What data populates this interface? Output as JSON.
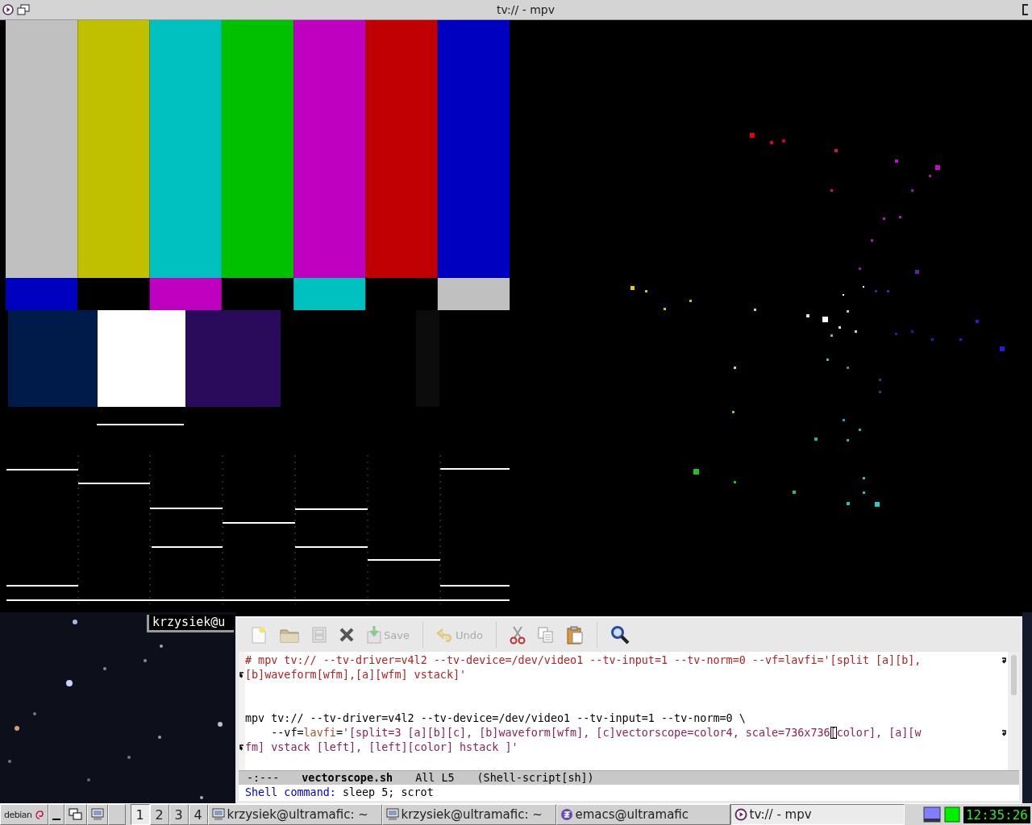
{
  "window": {
    "title": "tv:// - mpv"
  },
  "terminal": {
    "text": "krzysiek@u"
  },
  "editor": {
    "toolbar": [
      {
        "kind": "new",
        "disabled": false
      },
      {
        "kind": "open",
        "disabled": false
      },
      {
        "kind": "disk",
        "disabled": true
      },
      {
        "kind": "close",
        "disabled": false
      },
      {
        "kind": "save",
        "label": "Save",
        "disabled": true
      },
      {
        "kind": "separator"
      },
      {
        "kind": "undo",
        "label": "Undo",
        "disabled": true
      },
      {
        "kind": "separator"
      },
      {
        "kind": "cut",
        "disabled": false
      },
      {
        "kind": "copy",
        "disabled": false
      },
      {
        "kind": "paste",
        "disabled": false
      },
      {
        "kind": "separator"
      },
      {
        "kind": "search",
        "disabled": false
      }
    ],
    "lines": [
      {
        "kind": "code",
        "wrap_end": true,
        "segments": [
          {
            "kind": "comment",
            "text": "# mpv tv:// --tv-driver=v4l2 --tv-device=/dev/video1 --tv-input=1 --tv-norm=0 --vf=lavfi='[split [a][b],"
          }
        ]
      },
      {
        "kind": "code",
        "wrap_start": true,
        "segments": [
          {
            "kind": "comment",
            "text": "[b]waveform[wfm],[a][wfm] vstack]'"
          }
        ]
      },
      {
        "kind": "blank"
      },
      {
        "kind": "blank"
      },
      {
        "kind": "code",
        "segments": [
          {
            "kind": "plain",
            "text": "mpv tv:// --tv-driver=v4l2 --tv-device=/dev/video1 --tv-input=1 --tv-norm=0 \\"
          }
        ]
      },
      {
        "kind": "code",
        "wrap_end": true,
        "segments": [
          {
            "kind": "plain",
            "text": "    --vf="
          },
          {
            "kind": "variable",
            "text": "lavfi"
          },
          {
            "kind": "plain",
            "text": "="
          },
          {
            "kind": "string",
            "text": "'[split=3 [a][b][c], [b]waveform[wfm], [c]vectorscope=color4, scale=736x736"
          },
          {
            "kind": "cursor",
            "text": "["
          },
          {
            "kind": "string",
            "text": "color], [a][w"
          }
        ]
      },
      {
        "kind": "code",
        "wrap_start": true,
        "segments": [
          {
            "kind": "string",
            "text": "fm] vstack [left], [left][color] hstack ]'"
          }
        ]
      }
    ],
    "mode_line": [
      {
        "kind": "plain",
        "text": "-:---"
      },
      {
        "kind": "buffer",
        "text": "vectorscope.sh"
      },
      {
        "kind": "plain",
        "text": "All L5"
      },
      {
        "kind": "plain",
        "text": "(Shell-script[sh])"
      }
    ],
    "minibuffer": {
      "prompt": "Shell command:",
      "value": "sleep 5; scrot"
    }
  },
  "taskbar": {
    "start": "debian",
    "desktops": [
      {
        "label": "1",
        "selected": true
      },
      {
        "label": "2",
        "selected": false
      },
      {
        "label": "3",
        "selected": false
      },
      {
        "label": "4",
        "selected": false
      }
    ],
    "tasks": [
      {
        "kind": "terminal",
        "label": "krzysiek@ultramafic: ~",
        "selected": false
      },
      {
        "kind": "terminal",
        "label": "krzysiek@ultramafic: ~",
        "selected": false
      },
      {
        "kind": "emacs",
        "label": "emacs@ultramafic",
        "selected": false
      },
      {
        "kind": "mpv",
        "label": "tv:// - mpv",
        "selected": true
      }
    ],
    "clock": "12:35:26"
  }
}
